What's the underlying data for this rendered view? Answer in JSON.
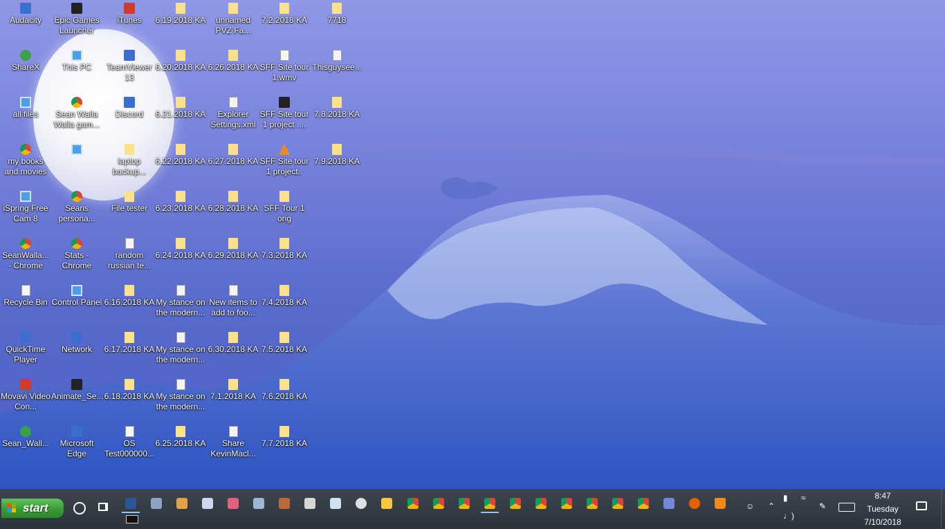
{
  "desktop": {
    "icons": [
      {
        "label": "Audacity",
        "icon": "audacity-icon"
      },
      {
        "label": "Epic Games Launcher",
        "icon": "epic-games-icon"
      },
      {
        "label": "iTunes",
        "icon": "itunes-icon"
      },
      {
        "label": "6.19.2018 KA",
        "icon": "folder-icon"
      },
      {
        "label": "unnamed PVZ Fa...",
        "icon": "folder-icon"
      },
      {
        "label": "7.2.2018 KA",
        "icon": "folder-icon"
      },
      {
        "label": "7718",
        "icon": "folder-icon"
      },
      {
        "label": "ShareX",
        "icon": "sharex-icon"
      },
      {
        "label": "This PC",
        "icon": "this-pc-icon"
      },
      {
        "label": "TeamViewer 13",
        "icon": "teamviewer-icon"
      },
      {
        "label": "6.20.2018 KA",
        "icon": "folder-icon"
      },
      {
        "label": "6.26.2018 KA",
        "icon": "folder-icon"
      },
      {
        "label": "SFF Site tour 1.wmv",
        "icon": "video-file-icon"
      },
      {
        "label": "Thisguysee...",
        "icon": "document-icon"
      },
      {
        "label": "all files",
        "icon": "monitor-icon"
      },
      {
        "label": "Sean Walla Walla gam...",
        "icon": "chrome-icon"
      },
      {
        "label": "Discord",
        "icon": "discord-icon"
      },
      {
        "label": "6.21.2018 KA",
        "icon": "folder-icon"
      },
      {
        "label": "Explorer Settings.xml",
        "icon": "xml-file-icon"
      },
      {
        "label": "SFF Site tour 1 project ....",
        "icon": "film-icon"
      },
      {
        "label": "7.8.2018 KA",
        "icon": "folder-icon"
      },
      {
        "label": "my books and movies",
        "icon": "books-icon"
      },
      {
        "label": "",
        "icon": "control-panel-icon"
      },
      {
        "label": "laptop backup...",
        "icon": "folder-icon"
      },
      {
        "label": "6.22.2018 KA",
        "icon": "folder-icon"
      },
      {
        "label": "6.27.2018 KA",
        "icon": "folder-icon"
      },
      {
        "label": "SFF Site tour 1 project..",
        "icon": "vlc-icon"
      },
      {
        "label": "7.9.2018 KA",
        "icon": "folder-icon"
      },
      {
        "label": "iSpring Free Cam 8",
        "icon": "ispring-icon"
      },
      {
        "label": "Seans persona...",
        "icon": "chrome-icon"
      },
      {
        "label": "File tester",
        "icon": "folder-icon"
      },
      {
        "label": "6.23.2018 KA",
        "icon": "folder-icon"
      },
      {
        "label": "6.28.2018 KA",
        "icon": "folder-icon"
      },
      {
        "label": "SFF Tour 1 orig",
        "icon": "folder-icon"
      },
      {
        "label": "SeanWalla... - Chrome",
        "icon": "chrome-icon"
      },
      {
        "label": "Stats - Chrome",
        "icon": "chrome-icon"
      },
      {
        "label": "random russian te...",
        "icon": "document-icon"
      },
      {
        "label": "6.24.2018 KA",
        "icon": "folder-icon"
      },
      {
        "label": "6.29.2018 KA",
        "icon": "folder-icon"
      },
      {
        "label": "7.3.2018 KA",
        "icon": "folder-icon"
      },
      {
        "label": "Recycle Bin",
        "icon": "recycle-bin-icon"
      },
      {
        "label": "Control Panel",
        "icon": "control-panel-icon"
      },
      {
        "label": "6.16.2018 KA",
        "icon": "folder-icon"
      },
      {
        "label": "My stance on the modern...",
        "icon": "document-icon"
      },
      {
        "label": "New items to add to foo...",
        "icon": "document-icon"
      },
      {
        "label": "7.4.2018 KA",
        "icon": "folder-icon"
      },
      {
        "label": "QuickTime Player",
        "icon": "quicktime-icon"
      },
      {
        "label": "Network",
        "icon": "network-icon"
      },
      {
        "label": "6.17.2018 KA",
        "icon": "folder-icon"
      },
      {
        "label": "My stance on the modern...",
        "icon": "word-document-icon"
      },
      {
        "label": "6.30.2018 KA",
        "icon": "folder-icon"
      },
      {
        "label": "7.5.2018 KA",
        "icon": "folder-icon"
      },
      {
        "label": "Movavi Video Con...",
        "icon": "movavi-icon"
      },
      {
        "label": "Animate_Se...",
        "icon": "animate-icon"
      },
      {
        "label": "6.18.2018 KA",
        "icon": "folder-icon"
      },
      {
        "label": "My stance on the modern...",
        "icon": "image-file-icon"
      },
      {
        "label": "7.1.2018 KA",
        "icon": "folder-icon"
      },
      {
        "label": "7.6.2018 KA",
        "icon": "folder-icon"
      },
      {
        "label": "Sean_Wall...",
        "icon": "user-shortcut-icon"
      },
      {
        "label": "Microsoft Edge",
        "icon": "edge-icon"
      },
      {
        "label": "OS Test000000...",
        "icon": "word-document-icon"
      },
      {
        "label": "6.25.2018 KA",
        "icon": "folder-icon"
      },
      {
        "label": "Share KevinMacl...",
        "icon": "document-icon"
      },
      {
        "label": "7.7.2018 KA",
        "icon": "folder-icon"
      }
    ]
  },
  "taskbar": {
    "start_label": "start",
    "pinned": [
      {
        "icon": "word-icon",
        "active": true
      },
      {
        "icon": "tweak-icon",
        "active": false
      },
      {
        "icon": "paint-icon",
        "active": false
      },
      {
        "icon": "notepad-icon",
        "active": false
      },
      {
        "icon": "paint-3d-icon",
        "active": false
      },
      {
        "icon": "photos-icon",
        "active": false
      },
      {
        "icon": "film-icon",
        "active": false
      },
      {
        "icon": "calculator-icon",
        "active": false
      },
      {
        "icon": "notebook-icon",
        "active": false
      },
      {
        "icon": "settings-gear-icon",
        "active": false
      },
      {
        "icon": "file-explorer-icon",
        "active": false
      },
      {
        "icon": "chrome-icon",
        "active": false
      },
      {
        "icon": "chrome-icon",
        "active": false
      },
      {
        "icon": "chrome-icon",
        "active": false
      },
      {
        "icon": "chrome-icon",
        "active": true
      },
      {
        "icon": "chrome-icon",
        "active": false
      },
      {
        "icon": "chrome-icon",
        "active": false
      },
      {
        "icon": "chrome-icon",
        "active": false
      },
      {
        "icon": "chrome-icon",
        "active": false
      },
      {
        "icon": "chrome-icon",
        "active": false
      },
      {
        "icon": "chrome-icon",
        "active": false
      },
      {
        "icon": "discord-icon",
        "active": false
      },
      {
        "icon": "firefox-icon",
        "active": false
      },
      {
        "icon": "vlc-icon",
        "active": false
      }
    ],
    "clock": {
      "time": "8:47",
      "day": "Tuesday",
      "date": "7/10/2018"
    }
  },
  "colors": {
    "start_green": "#3b9a34",
    "folder": "#fbe28a",
    "taskbar": "#2f3740"
  }
}
